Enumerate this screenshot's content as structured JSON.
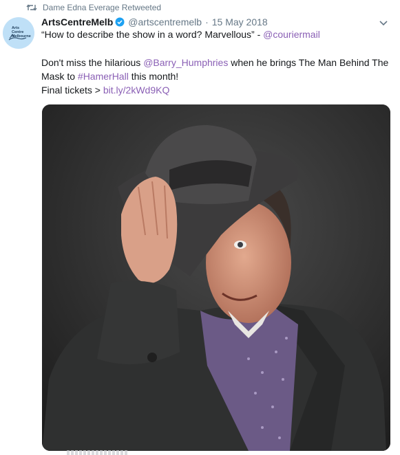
{
  "retweet": {
    "label": "Dame Edna Everage Retweeted",
    "icon": "retweet-icon"
  },
  "author": {
    "avatar_text": "Arts\nCentre\nMelbourne",
    "display_name": "ArtsCentreMelb",
    "verified_icon": "verified-badge-icon",
    "handle": "@artscentremelb",
    "separator": "·",
    "date": "15 May 2018"
  },
  "menu": {
    "icon": "chevron-down-icon"
  },
  "tweet": {
    "quote": "“How to describe the show in a word? Marvellous” - ",
    "quote_mention": "@couriermail",
    "body_1": "Don't miss the hilarious ",
    "mention": "@Barry_Humphries",
    "body_2": " when he brings The Man Behind The Mask to ",
    "hashtag": "#HamerHall",
    "body_3": " this month!",
    "tickets_label": "Final tickets > ",
    "link": "bit.ly/2kWd9KQ"
  },
  "colors": {
    "link": "#8a5fb5",
    "verified": "#1da1f2",
    "meta": "#657786",
    "photo_bg": "#222222",
    "avatar_bg": "#bfe0f7"
  }
}
